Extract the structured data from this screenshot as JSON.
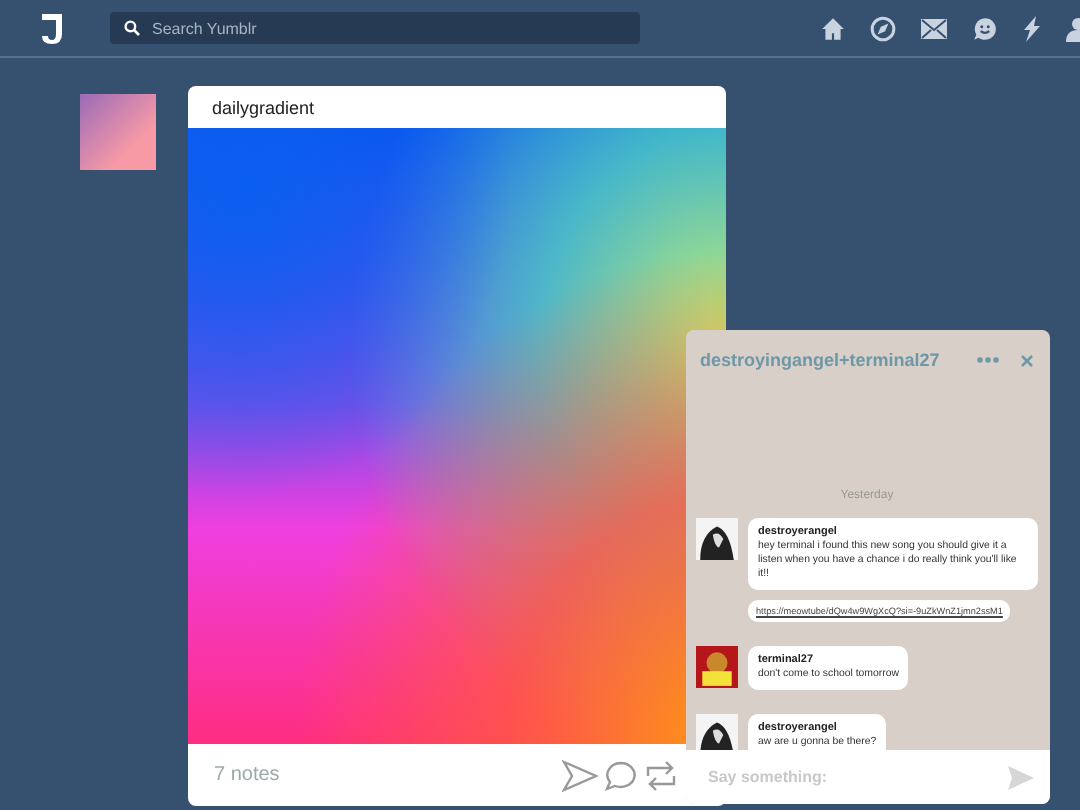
{
  "header": {
    "search": {
      "placeholder": "Search Yumblr"
    }
  },
  "post": {
    "blog": "dailygradient",
    "notes": "7 notes"
  },
  "chat": {
    "title": "destroyingangel+terminal27",
    "date": "Yesterday",
    "messages": [
      {
        "author": "destroyerangel",
        "text": "hey terminal i found this new song you should give it a listen when you have a chance i do really think you'll like it!!",
        "link": "https://meowtube/dQw4w9WgXcQ?si=-9uZkWnZ1jmn2ssM1",
        "kind": "dark"
      },
      {
        "author": "terminal27",
        "text": "don't come to school tomorrow",
        "kind": "red"
      },
      {
        "author": "destroyerangel",
        "text": "aw are u gonna be there?",
        "kind": "dark"
      }
    ],
    "input": {
      "placeholder": "Say something:"
    }
  }
}
